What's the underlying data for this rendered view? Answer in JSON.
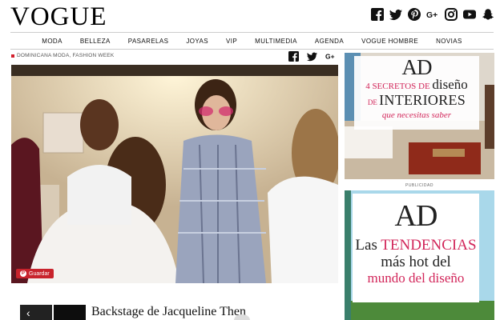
{
  "header": {
    "logo": "VOGUE",
    "social_icons": [
      "facebook-icon",
      "twitter-icon",
      "pinterest-icon",
      "googleplus-icon",
      "instagram-icon",
      "youtube-icon",
      "snapchat-icon"
    ]
  },
  "nav": {
    "items": [
      "MODA",
      "BELLEZA",
      "PASARELAS",
      "JOYAS",
      "VIP",
      "MULTIMEDIA",
      "AGENDA",
      "VOGUE HOMBRE",
      "NOVIAS"
    ]
  },
  "article": {
    "breadcrumb": "DOMINICANA MODA, FASHION WEEK",
    "share_icons": [
      "facebook-icon",
      "twitter-icon",
      "googleplus-icon"
    ],
    "save_button": "Guardar",
    "title": "Backstage de Jacqueline Then"
  },
  "ads": {
    "ad1": {
      "logo": "AD",
      "line1_small": "4 SECRETOS DE",
      "line1_big": "diseño",
      "line2_small": "DE",
      "line2_big": "INTERIORES",
      "line3": "que necesitas saber"
    },
    "label": "PUBLICIDAD",
    "ad2": {
      "logo": "AD",
      "line1_a": "Las",
      "line1_b": "TENDENCIAS",
      "line2": "más hot del",
      "line3": "mundo del diseño"
    }
  },
  "colors": {
    "accent": "#d2265a",
    "pinterest": "#c8232c"
  }
}
